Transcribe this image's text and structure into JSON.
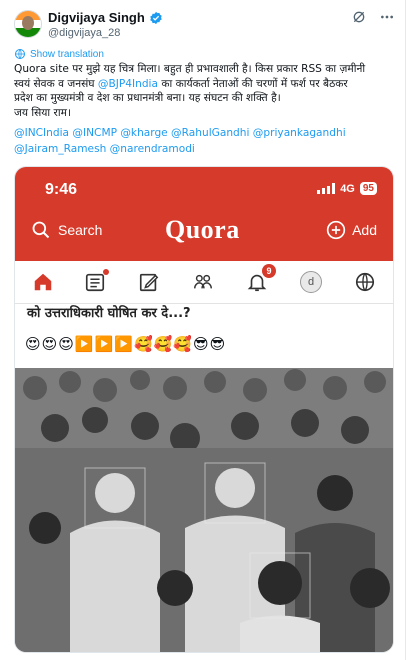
{
  "author": {
    "name": "Digvijaya Singh",
    "handle": "@digvijaya_28"
  },
  "show_translation": "Show translation",
  "tweet_lines": [
    "Quora site पर मुझे यह चित्र मिला। बहुत ही प्रभावशाली है। किस प्रकार RSS का ज़मीनी",
    "प्रदेश का मुख्यमंत्री व देश का प्रधानमंत्री बना। यह संघटन की शक्ति है।",
    "जय सिया राम।"
  ],
  "tweet_line2": {
    "pre": "स्वयं सेवक व जनसंघ ",
    "mention": "@BJP4India",
    "post": " का कार्यकर्ता नेताओं की चरणों में फर्श पर बैठकर"
  },
  "tags": {
    "line1": "@INCIndia @INCMP @kharge @RahulGandhi @priyankagandhi",
    "line2": "@Jairam_Ramesh @narendramodi"
  },
  "quora": {
    "time": "9:46",
    "network": "4G",
    "battery": "95",
    "search_label": "Search",
    "logo": "Quora",
    "add_label": "Add",
    "notification_count": "9",
    "avatar_letter": "d",
    "question_title": "को उत्तराधिकारी घोषित कर दे...?",
    "emoji_row": "😍😍😍▶️▶️▶️🥰🥰🥰😎😎"
  },
  "colors": {
    "quora_red": "#d63a2a",
    "twitter_blue": "#1d9bf0"
  },
  "icons": [
    "verified-icon",
    "grok-icon",
    "more-icon",
    "translate-icon",
    "search-icon",
    "add-icon",
    "home-icon",
    "answer-list-icon",
    "edit-icon",
    "spaces-icon",
    "bell-icon",
    "globe-icon"
  ]
}
